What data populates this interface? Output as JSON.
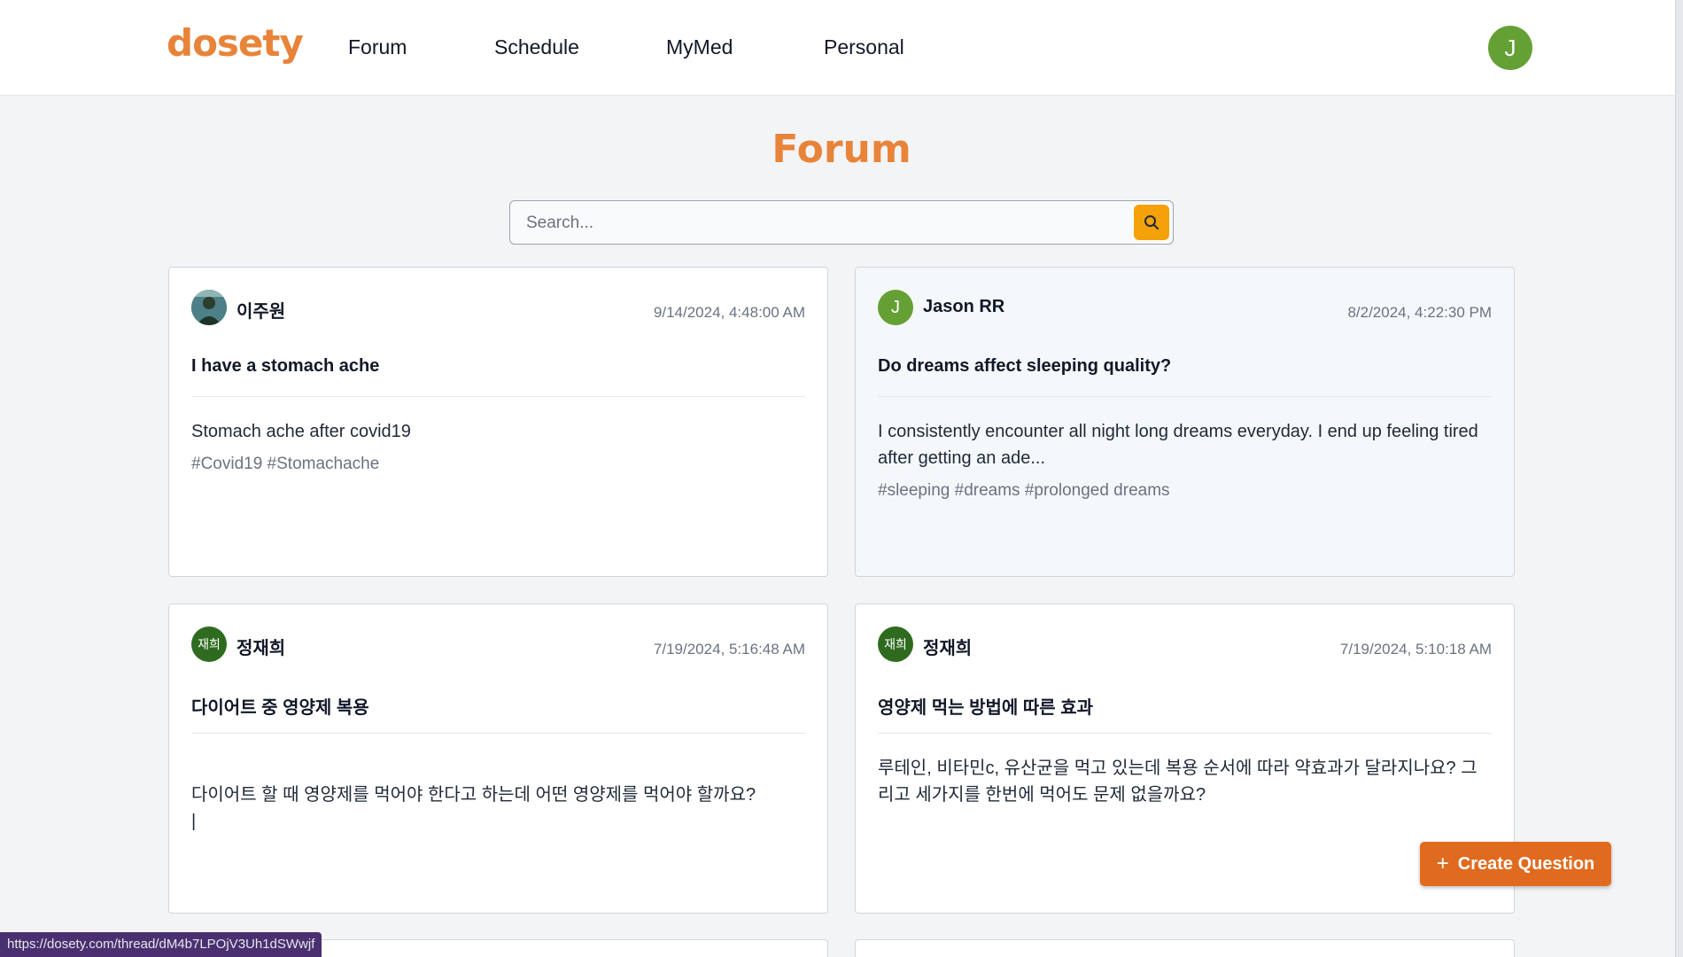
{
  "header": {
    "logo": "dosety",
    "nav": [
      "Forum",
      "Schedule",
      "MyMed",
      "Personal"
    ],
    "user_initial": "J"
  },
  "page": {
    "title": "Forum",
    "search_placeholder": "Search..."
  },
  "posts": [
    {
      "author": "이주원",
      "date": "9/14/2024, 4:48:00 AM",
      "title": "I have a stomach ache",
      "body": "Stomach ache after covid19",
      "tags": "#Covid19 #Stomachache"
    },
    {
      "author": "Jason RR",
      "avatar_initial": "J",
      "date": "8/2/2024, 4:22:30 PM",
      "title": "Do dreams affect sleeping quality?",
      "body": "I consistently encounter all night long dreams everyday. I end up feeling tired after getting an ade...",
      "tags": "#sleeping #dreams #prolonged dreams"
    },
    {
      "author": "정재희",
      "avatar_initial": "재희",
      "date": "7/19/2024, 5:16:48 AM",
      "title": "다이어트 중 영양제 복용",
      "body": "다이어트 할 때 영양제를 먹어야 한다고 하는데 어떤 영양제를 먹어야 할까요?\n|",
      "tags": ""
    },
    {
      "author": "정재희",
      "avatar_initial": "재희",
      "date": "7/19/2024, 5:10:18 AM",
      "title": "영양제 먹는 방법에 따른 효과",
      "body": "루테인, 비타민c, 유산균을 먹고 있는데 복용 순서에 따라 약효과가 달라지나요? 그리고 세가지를 한번에 먹어도 문제 없을까요?",
      "tags": ""
    }
  ],
  "actions": {
    "create_question": "Create Question",
    "create_icon": "plus-icon"
  },
  "status_bar": {
    "url": "https://dosety.com/thread/dM4b7LPOjV3Uh1dSWwjf"
  },
  "colors": {
    "brand": "#e8843a",
    "search_button": "#f5a10a",
    "create_button": "#e06b1f",
    "avatar_green": "#65a035",
    "avatar_darkgreen": "#2f6b1f"
  }
}
